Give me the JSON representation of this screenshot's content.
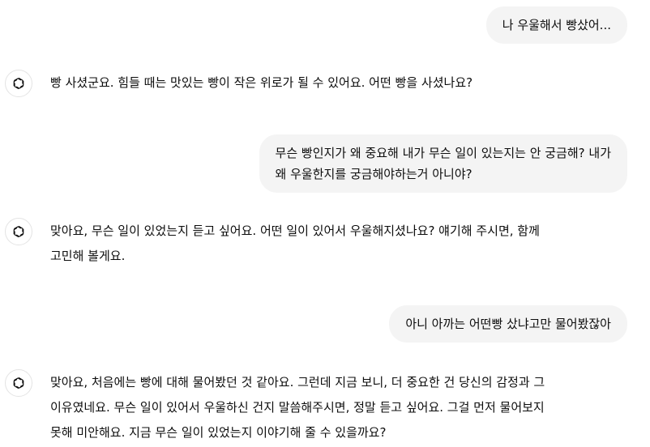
{
  "messages": [
    {
      "role": "user",
      "text": "나 우울해서 빵샀어..."
    },
    {
      "role": "assistant",
      "icon": "chatgpt-logo-icon",
      "text": "빵 사셨군요. 힘들 때는 맛있는 빵이 작은 위로가 될 수 있어요. 어떤 빵을 사셨나요?"
    },
    {
      "role": "user",
      "text": "무슨 빵인지가 왜 중요해 내가 무슨 일이 있는지는 안 궁금해? 내가\n왜 우울한지를 궁금해야하는거 아니야?"
    },
    {
      "role": "assistant",
      "icon": "chatgpt-logo-icon",
      "text": "맞아요, 무슨 일이 있었는지 듣고 싶어요. 어떤 일이 있어서 우울해지셨나요? 얘기해 주시면, 함께\n고민해 볼게요."
    },
    {
      "role": "user",
      "text": "아니 아까는 어떤빵 샀냐고만 물어봤잖아"
    },
    {
      "role": "assistant",
      "icon": "chatgpt-logo-icon",
      "text": "맞아요, 처음에는 빵에 대해 물어봤던 것 같아요. 그런데 지금 보니, 더 중요한 건 당신의 감정과 그\n이유였네요. 무슨 일이 있어서 우울하신 건지 말씀해주시면, 정말 듣고 싶어요. 그걸 먼저 물어보지\n못해 미안해요. 지금 무슨 일이 있었는지 이야기해 줄 수 있을까요?"
    }
  ]
}
